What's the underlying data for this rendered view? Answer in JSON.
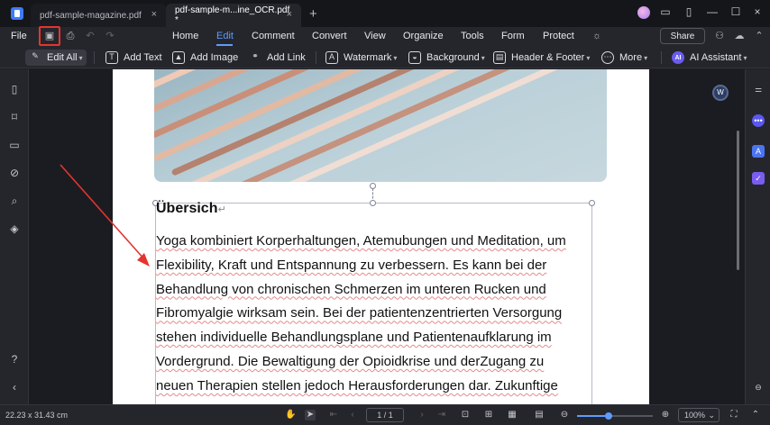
{
  "tabs": [
    {
      "label": "pdf-sample-magazine.pdf",
      "close": "×"
    },
    {
      "label": "pdf-sample-m...ine_OCR.pdf *",
      "close": "×"
    }
  ],
  "tab_add": "+",
  "window": {
    "minimize": "—",
    "maximize": "☐",
    "close": "×"
  },
  "menu": {
    "file": "File",
    "items": [
      "Home",
      "Edit",
      "Comment",
      "Convert",
      "View",
      "Organize",
      "Tools",
      "Form",
      "Protect"
    ],
    "active": "Edit",
    "share": "Share"
  },
  "toolbar": {
    "edit_all": "Edit All",
    "add_text": "Add Text",
    "add_image": "Add Image",
    "add_link": "Add Link",
    "watermark": "Watermark",
    "background": "Background",
    "header_footer": "Header & Footer",
    "more": "More",
    "ai_assistant": "AI Assistant",
    "ai_badge": "AI"
  },
  "document": {
    "heading": "Übersich",
    "paragraph_mark": "↵",
    "lines": [
      "Yoga kombiniert Korperhaltungen, Atemubungen und Meditation, um",
      "Flexibility, Kraft und Entspannung zu verbessern. Es kann bei der",
      "Behandlung von chronischen Schmerzen im unteren Rucken und",
      "Fibromyalgie wirksam sein. Bei der patientenzentrierten Versorgung",
      "stehen individuelle Behandlungsplane und Patientenaufklarung im",
      "Vordergrund. Die Bewaltigung der Opioidkrise und derZugang zu",
      "neuen Therapien stellen jedoch Herausforderungen dar. Zukunftige"
    ]
  },
  "word_badge": "W",
  "status": {
    "dimensions": "22.23 x 31.43 cm",
    "page": "1 / 1",
    "zoom": "100%",
    "zoom_fraction": 0.42
  },
  "colors": {
    "accent": "#5e9bff",
    "highlight_box": "#e5342f",
    "arrow": "#e5342f"
  }
}
